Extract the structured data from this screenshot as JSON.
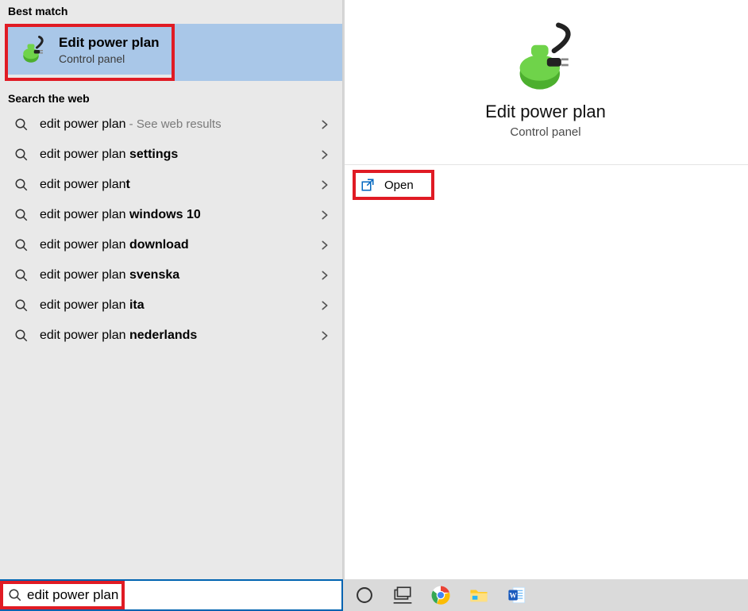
{
  "left": {
    "best_match_header": "Best match",
    "best_match": {
      "title": "Edit power plan",
      "subtitle": "Control panel"
    },
    "search_web_header": "Search the web",
    "web_items": [
      {
        "prefix": "edit power plan",
        "suffix": "",
        "extra": " - See web results"
      },
      {
        "prefix": "edit power plan ",
        "suffix": "settings",
        "extra": ""
      },
      {
        "prefix": "edit power plan",
        "suffix": "t",
        "extra": ""
      },
      {
        "prefix": "edit power plan ",
        "suffix": "windows 10",
        "extra": ""
      },
      {
        "prefix": "edit power plan ",
        "suffix": "download",
        "extra": ""
      },
      {
        "prefix": "edit power plan ",
        "suffix": "svenska",
        "extra": ""
      },
      {
        "prefix": "edit power plan ",
        "suffix": "ita",
        "extra": ""
      },
      {
        "prefix": "edit power plan ",
        "suffix": "nederlands",
        "extra": ""
      }
    ]
  },
  "right": {
    "title": "Edit power plan",
    "subtitle": "Control panel",
    "open_label": "Open"
  },
  "search": {
    "value": "edit power plan"
  },
  "icons": {
    "cortana": "cortana-ring-icon",
    "taskview": "task-view-icon",
    "chrome": "chrome-icon",
    "explorer": "file-explorer-icon",
    "word": "word-icon"
  }
}
